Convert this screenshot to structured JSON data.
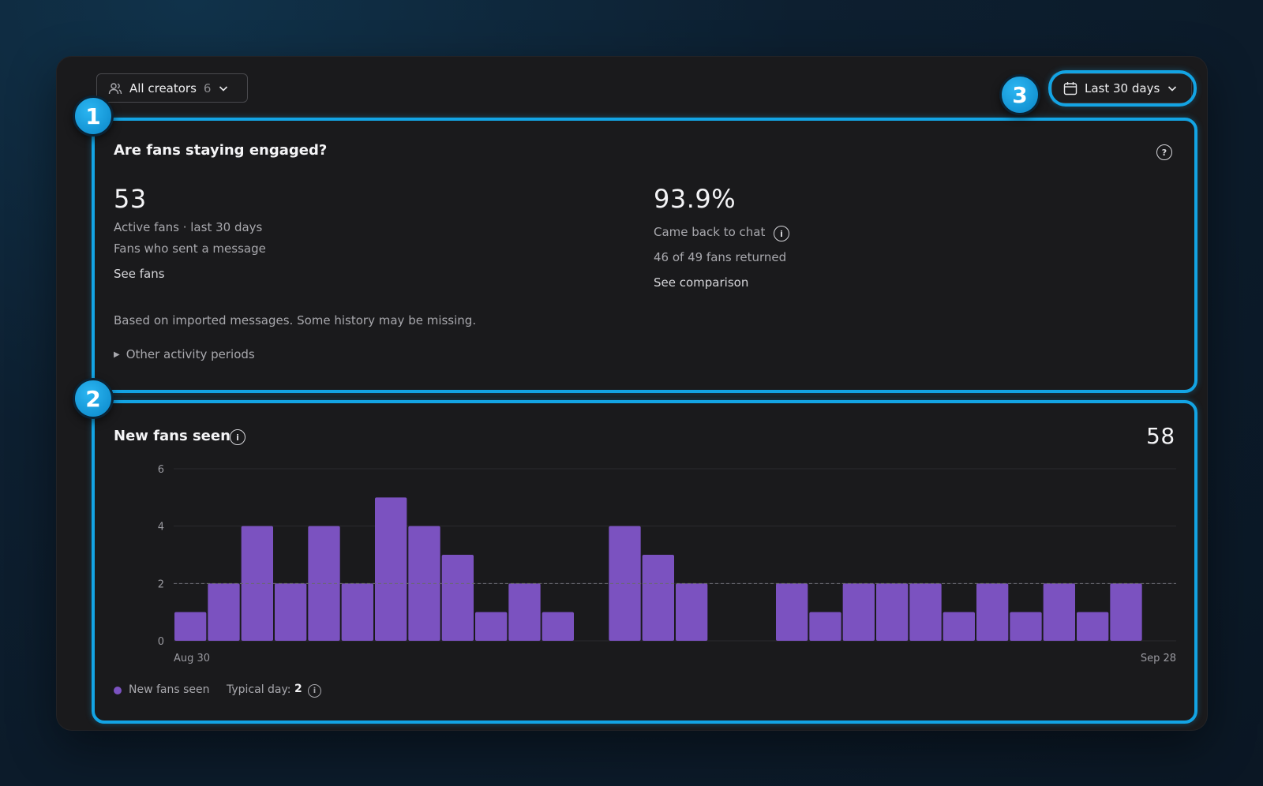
{
  "filters": {
    "creators_label": "All creators",
    "creators_count": "6",
    "date_range_label": "Last 30 days"
  },
  "callouts": [
    "1",
    "2",
    "3"
  ],
  "engagement": {
    "title": "Are fans staying engaged?",
    "active_value": "53",
    "active_label": "Active fans · last 30 days",
    "active_sublabel": "Fans who sent a message",
    "active_link": "See fans",
    "returned_value": "93.9%",
    "returned_label": "Came back to chat",
    "returned_sublabel": "46 of 49 fans returned",
    "returned_link": "See comparison",
    "note": "Based on imported messages. Some history may be missing.",
    "other_periods": "Other activity periods"
  },
  "new_fans": {
    "title": "New fans seen",
    "total": "58",
    "legend_label": "New fans seen",
    "typical_label": "Typical day:",
    "typical_value": "2"
  },
  "colors": {
    "accent": "#13a4e4",
    "bar": "#7b52c0",
    "card_bg": "#1a1a1c"
  },
  "chart_data": {
    "type": "bar",
    "x_start_label": "Aug 30",
    "x_end_label": "Sep 28",
    "y_ticks": [
      "0",
      "2",
      "4",
      "6"
    ],
    "ylim": [
      0,
      6
    ],
    "reference_line": 2,
    "values": [
      1,
      2,
      4,
      2,
      4,
      2,
      5,
      4,
      3,
      1,
      2,
      1,
      0,
      4,
      3,
      2,
      0,
      0,
      2,
      1,
      2,
      2,
      2,
      1,
      2,
      1,
      2,
      1,
      2,
      0
    ],
    "series": [
      {
        "name": "New fans seen"
      }
    ],
    "grid": true
  }
}
